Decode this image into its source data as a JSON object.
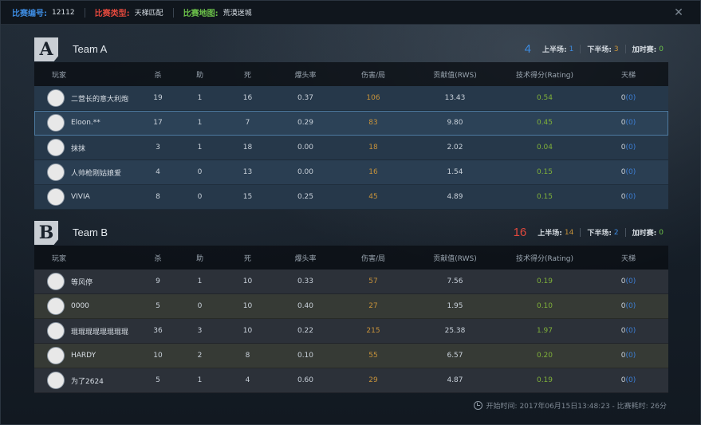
{
  "header": {
    "match_id_label": "比赛编号:",
    "match_id": "12112",
    "match_type_label": "比赛类型:",
    "match_type": "天梯匹配",
    "map_label": "比赛地图:",
    "map": "荒漠迷城",
    "close_glyph": "✕",
    "colors": {
      "match_id_label": "#3d8be0",
      "match_type_label": "#e0483d",
      "map_label": "#6cc24a"
    }
  },
  "columns": [
    "玩家",
    "杀",
    "助",
    "死",
    "爆头率",
    "伤害/局",
    "贡献值(RWS)",
    "技术得分(Rating)",
    "天梯"
  ],
  "team_a": {
    "logo": "A",
    "name": "Team A",
    "total": "4",
    "total_color": "#3d8be0",
    "first_half_label": "上半场:",
    "first_half": "1",
    "second_half_label": "下半场:",
    "second_half": "3",
    "overtime_label": "加时赛:",
    "overtime": "0",
    "players": [
      {
        "name": "二营长的意大利炮",
        "kills": "19",
        "assists": "1",
        "deaths": "16",
        "hs": "0.37",
        "dmg": "106",
        "rws": "13.43",
        "rating": "0.54",
        "ladder": "0",
        "ladder_change": "(0)"
      },
      {
        "name": "Eloon.**",
        "kills": "17",
        "assists": "1",
        "deaths": "7",
        "hs": "0.29",
        "dmg": "83",
        "rws": "9.80",
        "rating": "0.45",
        "ladder": "0",
        "ladder_change": "(0)"
      },
      {
        "name": "抹抹",
        "kills": "3",
        "assists": "1",
        "deaths": "18",
        "hs": "0.00",
        "dmg": "18",
        "rws": "2.02",
        "rating": "0.04",
        "ladder": "0",
        "ladder_change": "(0)"
      },
      {
        "name": "人帅枪刚姑娘爱",
        "kills": "4",
        "assists": "0",
        "deaths": "13",
        "hs": "0.00",
        "dmg": "16",
        "rws": "1.54",
        "rating": "0.15",
        "ladder": "0",
        "ladder_change": "(0)"
      },
      {
        "name": "VIVIA",
        "kills": "8",
        "assists": "0",
        "deaths": "15",
        "hs": "0.25",
        "dmg": "45",
        "rws": "4.89",
        "rating": "0.15",
        "ladder": "0",
        "ladder_change": "(0)"
      }
    ]
  },
  "team_b": {
    "logo": "B",
    "name": "Team B",
    "total": "16",
    "total_color": "#e0483d",
    "first_half_label": "上半场:",
    "first_half": "14",
    "second_half_label": "下半场:",
    "second_half": "2",
    "overtime_label": "加时赛:",
    "overtime": "0",
    "players": [
      {
        "name": "等风停",
        "kills": "9",
        "assists": "1",
        "deaths": "10",
        "hs": "0.33",
        "dmg": "57",
        "rws": "7.56",
        "rating": "0.19",
        "ladder": "0",
        "ladder_change": "(0)"
      },
      {
        "name": "0000",
        "kills": "5",
        "assists": "0",
        "deaths": "10",
        "hs": "0.40",
        "dmg": "27",
        "rws": "1.95",
        "rating": "0.10",
        "ladder": "0",
        "ladder_change": "(0)"
      },
      {
        "name": "琨琨琨琨琨琨琨琨",
        "kills": "36",
        "assists": "3",
        "deaths": "10",
        "hs": "0.22",
        "dmg": "215",
        "rws": "25.38",
        "rating": "1.97",
        "ladder": "0",
        "ladder_change": "(0)"
      },
      {
        "name": "HARDY",
        "kills": "10",
        "assists": "2",
        "deaths": "8",
        "hs": "0.10",
        "dmg": "55",
        "rws": "6.57",
        "rating": "0.20",
        "ladder": "0",
        "ladder_change": "(0)"
      },
      {
        "name": "为了2624",
        "kills": "5",
        "assists": "1",
        "deaths": "4",
        "hs": "0.60",
        "dmg": "29",
        "rws": "4.87",
        "rating": "0.19",
        "ladder": "0",
        "ladder_change": "(0)"
      }
    ]
  },
  "footer": {
    "text": "开始时间: 2017年06月15日13:48:23 - 比赛耗时: 26分"
  }
}
